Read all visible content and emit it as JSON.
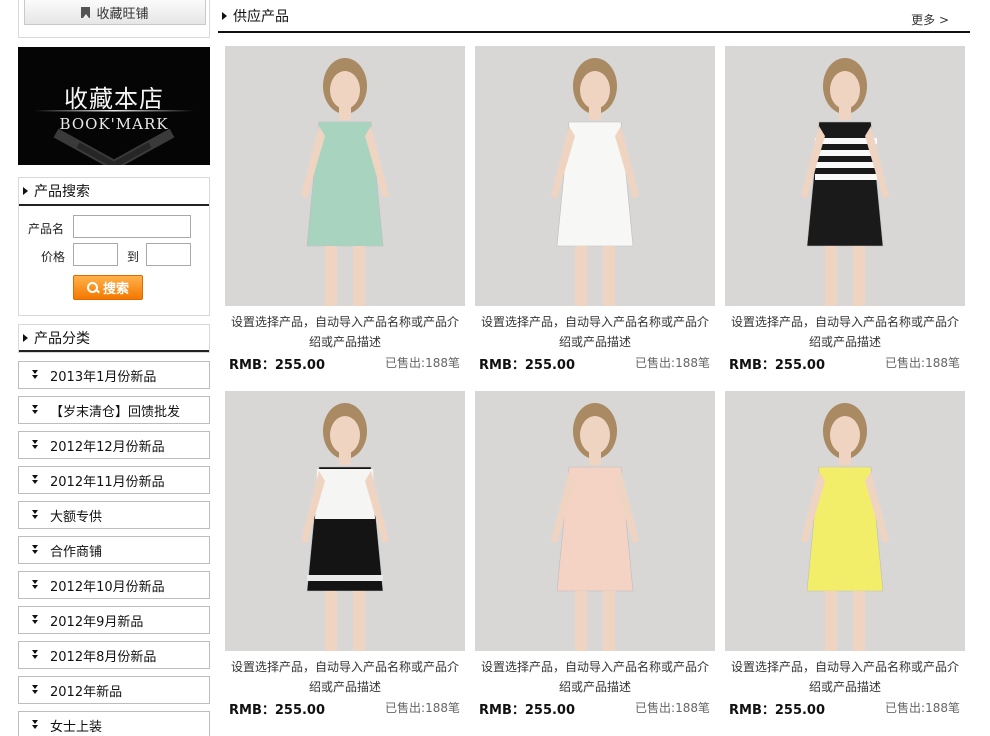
{
  "sidebar": {
    "fav_button": "收藏旺铺",
    "bookmark_banner": {
      "cn": "收藏本店",
      "en": "BOOK'MARK"
    },
    "search": {
      "title": "产品搜索",
      "name_label": "产品名",
      "price_label": "价格",
      "to_label": "到",
      "button": "搜索"
    },
    "categories": {
      "title": "产品分类",
      "items": [
        "2013年1月份新品",
        "【岁末清仓】回馈批发",
        "2012年12月份新品",
        "2012年11月份新品",
        "大额专供",
        "合作商铺",
        "2012年10月份新品",
        "2012年9月新品",
        "2012年8月份新品",
        "2012年新品",
        "女士上装"
      ]
    }
  },
  "main": {
    "title": "供应产品",
    "more": "更多 >",
    "products": [
      {
        "desc": "设置选择产品，自动导入产品名称或产品介绍或产品描述",
        "price": "RMB：255.00",
        "sold": "已售出:188笔",
        "dress_color": "#a8d4bf"
      },
      {
        "desc": "设置选择产品，自动导入产品名称或产品介绍或产品描述",
        "price": "RMB：255.00",
        "sold": "已售出:188笔",
        "dress_color": "#f7f7f5"
      },
      {
        "desc": "设置选择产品，自动导入产品名称或产品介绍或产品描述",
        "price": "RMB：255.00",
        "sold": "已售出:188笔",
        "dress_color": "#1a1a1a"
      },
      {
        "desc": "设置选择产品，自动导入产品名称或产品介绍或产品描述",
        "price": "RMB：255.00",
        "sold": "已售出:188笔",
        "dress_color": "#141414"
      },
      {
        "desc": "设置选择产品，自动导入产品名称或产品介绍或产品描述",
        "price": "RMB：255.00",
        "sold": "已售出:188笔",
        "dress_color": "#f4d2c4"
      },
      {
        "desc": "设置选择产品，自动导入产品名称或产品介绍或产品描述",
        "price": "RMB：255.00",
        "sold": "已售出:188笔",
        "dress_color": "#f3ee6a"
      }
    ]
  }
}
